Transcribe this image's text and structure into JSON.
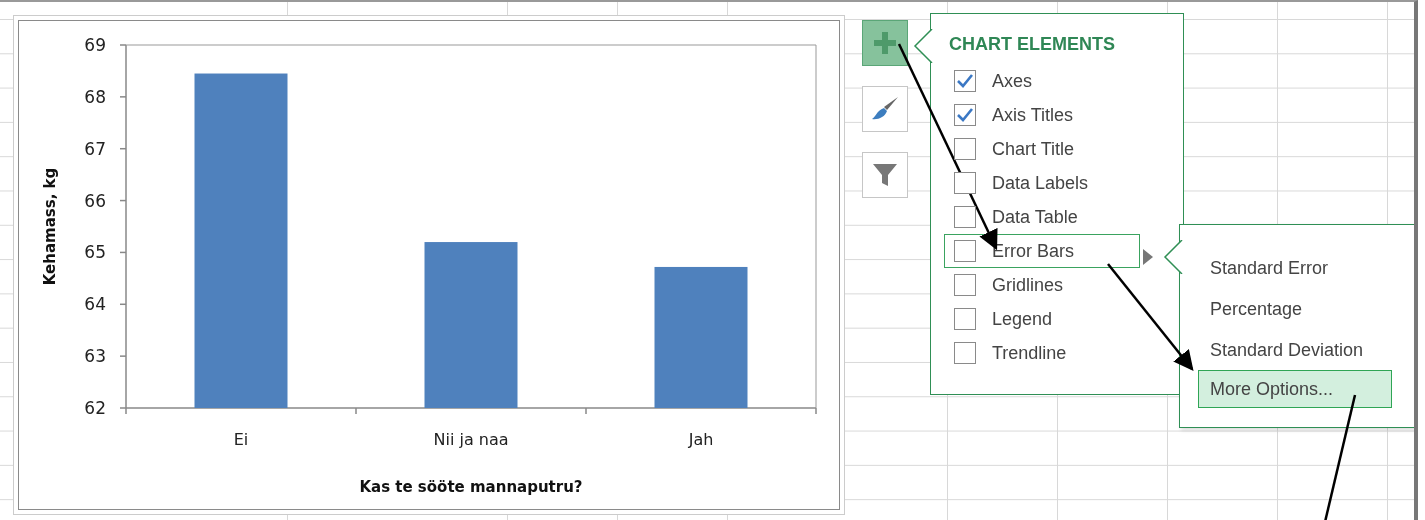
{
  "chart": {
    "chart_data": {
      "type": "bar",
      "xlabel": "Kas te sööte mannaputru?",
      "ylabel": "Kehamass, kg",
      "categories": [
        "Ei",
        "Nii ja naa",
        "Jah"
      ],
      "series": [
        {
          "color": "#4f81bd",
          "values": [
            68.45,
            65.2,
            64.72
          ]
        }
      ],
      "ylim": [
        62,
        69
      ],
      "yticks": [
        62,
        63,
        64,
        65,
        66,
        67,
        68,
        69
      ]
    }
  },
  "side_buttons": [
    {
      "kind": "add",
      "selected": true
    },
    {
      "kind": "style",
      "selected": false
    },
    {
      "kind": "filter",
      "selected": false
    }
  ],
  "chart_elements": {
    "title": "CHART ELEMENTS",
    "items": [
      {
        "label": "Axes",
        "checked": true,
        "selected": false
      },
      {
        "label": "Axis Titles",
        "checked": true,
        "selected": false
      },
      {
        "label": "Chart Title",
        "checked": false,
        "selected": false
      },
      {
        "label": "Data Labels",
        "checked": false,
        "selected": false
      },
      {
        "label": "Data Table",
        "checked": false,
        "selected": false
      },
      {
        "label": "Error Bars",
        "checked": false,
        "selected": true
      },
      {
        "label": "Gridlines",
        "checked": false,
        "selected": false
      },
      {
        "label": "Legend",
        "checked": false,
        "selected": false
      },
      {
        "label": "Trendline",
        "checked": false,
        "selected": false
      }
    ]
  },
  "error_bars_menu": {
    "items": [
      {
        "label": "Standard Error",
        "selected": false
      },
      {
        "label": "Percentage",
        "selected": false
      },
      {
        "label": "Standard Deviation",
        "selected": false
      },
      {
        "label": "More Options...",
        "selected": true
      }
    ]
  }
}
